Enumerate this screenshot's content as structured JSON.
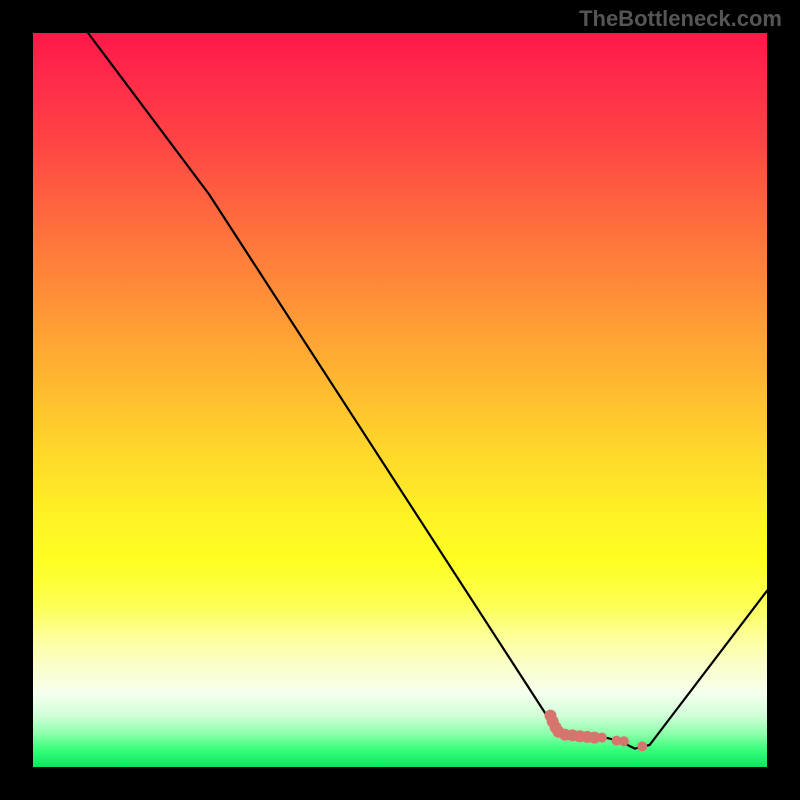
{
  "watermark": "TheBottleneck.com",
  "chart_data": {
    "type": "line",
    "title": "",
    "xlabel": "",
    "ylabel": "",
    "xlim": [
      0,
      100
    ],
    "ylim": [
      0,
      100
    ],
    "series": [
      {
        "name": "curve",
        "x": [
          0,
          24,
          70,
          72,
          78,
          80,
          82,
          84,
          100
        ],
        "values": [
          110,
          78,
          7,
          4,
          4,
          3.5,
          2.5,
          3,
          24
        ]
      }
    ],
    "markers": {
      "name": "scatter-points",
      "color": "#d7746e",
      "points": [
        {
          "x": 70.5,
          "y": 7.0,
          "r": 6
        },
        {
          "x": 70.8,
          "y": 6.2,
          "r": 6
        },
        {
          "x": 71.2,
          "y": 5.4,
          "r": 6
        },
        {
          "x": 71.6,
          "y": 4.8,
          "r": 6
        },
        {
          "x": 72.5,
          "y": 4.4,
          "r": 6
        },
        {
          "x": 73.5,
          "y": 4.3,
          "r": 6
        },
        {
          "x": 74.5,
          "y": 4.2,
          "r": 6
        },
        {
          "x": 75.5,
          "y": 4.1,
          "r": 6
        },
        {
          "x": 76.5,
          "y": 4.0,
          "r": 6
        },
        {
          "x": 77.5,
          "y": 4.0,
          "r": 5
        },
        {
          "x": 79.5,
          "y": 3.6,
          "r": 5
        },
        {
          "x": 80.5,
          "y": 3.5,
          "r": 5
        },
        {
          "x": 83.0,
          "y": 2.8,
          "r": 5
        }
      ]
    },
    "gradient_stops": [
      {
        "pct": 0,
        "color": "#ff1848"
      },
      {
        "pct": 6,
        "color": "#ff2a4a"
      },
      {
        "pct": 15,
        "color": "#ff4544"
      },
      {
        "pct": 25,
        "color": "#ff6a3e"
      },
      {
        "pct": 35,
        "color": "#ff8c38"
      },
      {
        "pct": 45,
        "color": "#ffaf32"
      },
      {
        "pct": 55,
        "color": "#ffd12c"
      },
      {
        "pct": 65,
        "color": "#fff026"
      },
      {
        "pct": 72,
        "color": "#feff22"
      },
      {
        "pct": 78,
        "color": "#fcff55"
      },
      {
        "pct": 82,
        "color": "#fcff95"
      },
      {
        "pct": 86,
        "color": "#fbffc8"
      },
      {
        "pct": 90,
        "color": "#f5ffee"
      },
      {
        "pct": 93,
        "color": "#d0ffd8"
      },
      {
        "pct": 95.5,
        "color": "#8cffaa"
      },
      {
        "pct": 97.5,
        "color": "#3cff7e"
      },
      {
        "pct": 100,
        "color": "#06e95a"
      }
    ]
  }
}
